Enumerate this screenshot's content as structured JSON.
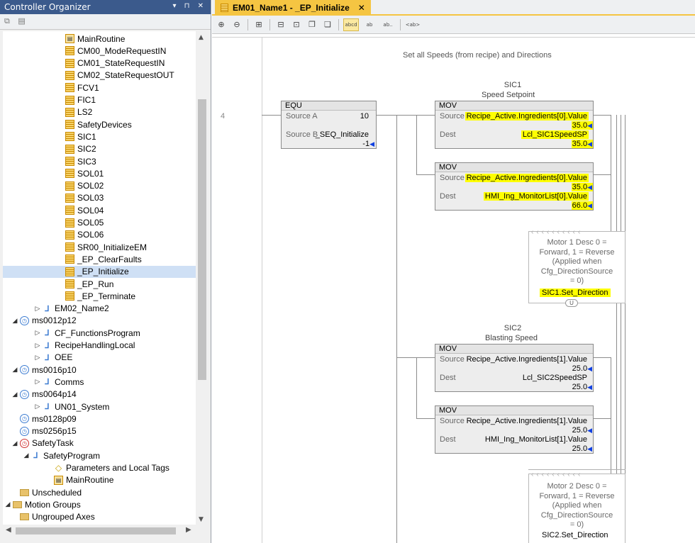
{
  "organizer": {
    "title": "Controller Organizer",
    "controls": "▾ ⊓ ✕",
    "toolbar_icons": [
      "collapse-all-icon",
      "expand-all-icon"
    ],
    "items": [
      {
        "label": "MainRoutine",
        "icon": "main-routine-icon",
        "indent": 5,
        "expander": ""
      },
      {
        "label": "CM00_ModeRequestIN",
        "icon": "routine-icon",
        "indent": 5,
        "expander": ""
      },
      {
        "label": "CM01_StateRequestIN",
        "icon": "routine-icon",
        "indent": 5,
        "expander": ""
      },
      {
        "label": "CM02_StateRequestOUT",
        "icon": "routine-icon",
        "indent": 5,
        "expander": ""
      },
      {
        "label": "FCV1",
        "icon": "routine-icon",
        "indent": 5,
        "expander": ""
      },
      {
        "label": "FIC1",
        "icon": "routine-icon",
        "indent": 5,
        "expander": ""
      },
      {
        "label": "LS2",
        "icon": "routine-icon",
        "indent": 5,
        "expander": ""
      },
      {
        "label": "SafetyDevices",
        "icon": "routine-icon",
        "indent": 5,
        "expander": ""
      },
      {
        "label": "SIC1",
        "icon": "routine-icon",
        "indent": 5,
        "expander": ""
      },
      {
        "label": "SIC2",
        "icon": "routine-icon",
        "indent": 5,
        "expander": ""
      },
      {
        "label": "SIC3",
        "icon": "routine-icon",
        "indent": 5,
        "expander": ""
      },
      {
        "label": "SOL01",
        "icon": "routine-icon",
        "indent": 5,
        "expander": ""
      },
      {
        "label": "SOL02",
        "icon": "routine-icon",
        "indent": 5,
        "expander": ""
      },
      {
        "label": "SOL03",
        "icon": "routine-icon",
        "indent": 5,
        "expander": ""
      },
      {
        "label": "SOL04",
        "icon": "routine-icon",
        "indent": 5,
        "expander": ""
      },
      {
        "label": "SOL05",
        "icon": "routine-icon",
        "indent": 5,
        "expander": ""
      },
      {
        "label": "SOL06",
        "icon": "routine-icon",
        "indent": 5,
        "expander": ""
      },
      {
        "label": "SR00_InitializeEM",
        "icon": "routine-icon",
        "indent": 5,
        "expander": ""
      },
      {
        "label": "_EP_ClearFaults",
        "icon": "routine-icon",
        "indent": 5,
        "expander": ""
      },
      {
        "label": "_EP_Initialize",
        "icon": "routine-icon",
        "indent": 5,
        "expander": "",
        "selected": true
      },
      {
        "label": "_EP_Run",
        "icon": "routine-icon",
        "indent": 5,
        "expander": ""
      },
      {
        "label": "_EP_Terminate",
        "icon": "routine-icon",
        "indent": 5,
        "expander": ""
      },
      {
        "label": "EM02_Name2",
        "icon": "program-icon",
        "indent": 3,
        "expander": "▷"
      },
      {
        "label": "ms0012p12",
        "icon": "periodic-task-icon",
        "indent": 1,
        "expander": "◢"
      },
      {
        "label": "CF_FunctionsProgram",
        "icon": "program-icon",
        "indent": 3,
        "expander": "▷"
      },
      {
        "label": "RecipeHandlingLocal",
        "icon": "program-icon",
        "indent": 3,
        "expander": "▷"
      },
      {
        "label": "OEE",
        "icon": "program-icon",
        "indent": 3,
        "expander": "▷"
      },
      {
        "label": "ms0016p10",
        "icon": "periodic-task-icon",
        "indent": 1,
        "expander": "◢"
      },
      {
        "label": "Comms",
        "icon": "program-icon",
        "indent": 3,
        "expander": "▷"
      },
      {
        "label": "ms0064p14",
        "icon": "periodic-task-icon",
        "indent": 1,
        "expander": "◢"
      },
      {
        "label": "UN01_System",
        "icon": "program-icon",
        "indent": 3,
        "expander": "▷"
      },
      {
        "label": "ms0128p09",
        "icon": "periodic-task-icon",
        "indent": 1,
        "expander": ""
      },
      {
        "label": "ms0256p15",
        "icon": "periodic-task-icon",
        "indent": 1,
        "expander": ""
      },
      {
        "label": "SafetyTask",
        "icon": "safety-task-icon",
        "indent": 1,
        "expander": "◢"
      },
      {
        "label": "SafetyProgram",
        "icon": "safety-program-icon",
        "indent": 2,
        "expander": "◢"
      },
      {
        "label": "Parameters and Local Tags",
        "icon": "tag-icon",
        "indent": 4,
        "expander": ""
      },
      {
        "label": "MainRoutine",
        "icon": "main-routine-icon",
        "indent": 4,
        "expander": ""
      },
      {
        "label": "Unscheduled",
        "icon": "folder-icon",
        "indent": 1,
        "expander": ""
      },
      {
        "label": "Motion Groups",
        "icon": "folder-icon",
        "indent": 0,
        "expander": "◢"
      },
      {
        "label": "Ungrouped Axes",
        "icon": "folder-icon",
        "indent": 1,
        "expander": ""
      }
    ]
  },
  "editor": {
    "tab_label": "EM01_Name1 - _EP_Initialize",
    "tab_close": "✕",
    "toolbar": [
      "zoom-in-icon",
      "zoom-out-icon",
      "sep",
      "verify-icon",
      "sep",
      "rung-icon",
      "branch-icon",
      "copy-icon",
      "paste-icon",
      "sep",
      "tag-desc-toggle-icon",
      "ab-swap-icon",
      "ab-find-icon",
      "sep",
      "ab-tag-icon"
    ],
    "toolbar_labels": {
      "tag-desc-toggle-icon": "abcd",
      "ab-swap-icon": "ab",
      "ab-find-icon": "ab..",
      "ab-tag-icon": "<ab>"
    }
  },
  "ladder": {
    "rung_comment": "Set all Speeds (from recipe) and Directions",
    "rung_number": "4",
    "equ": {
      "name": "EQU",
      "source_a_label": "Source A",
      "source_a_value": "10",
      "source_b_label": "Source B",
      "source_b_tag": "_SEQ_Initialize",
      "source_b_value": "-1"
    },
    "sic1_title": "SIC1",
    "sic1_sub": "Speed Setpoint",
    "sic2_title": "SIC2",
    "sic2_sub": "Blasting Speed",
    "mov1": {
      "name": "MOV",
      "source_label": "Source",
      "source_tag": "Recipe_Active.Ingredients[0].Value",
      "source_value": "35.0",
      "dest_label": "Dest",
      "dest_tag": "Lcl_SIC1SpeedSP",
      "dest_value": "35.0"
    },
    "mov2": {
      "name": "MOV",
      "source_label": "Source",
      "source_tag": "Recipe_Active.Ingredients[0].Value",
      "source_value": "35.0",
      "dest_label": "Dest",
      "dest_tag": "HMI_Ing_MonitorList[0].Value",
      "dest_value": "66.0"
    },
    "mov3": {
      "name": "MOV",
      "source_label": "Source",
      "source_tag": "Recipe_Active.Ingredients[1].Value",
      "source_value": "25.0",
      "dest_label": "Dest",
      "dest_tag": "Lcl_SIC2SpeedSP",
      "dest_value": "25.0"
    },
    "mov4": {
      "name": "MOV",
      "source_label": "Source",
      "source_tag": "Recipe_Active.Ingredients[1].Value",
      "source_value": "25.0",
      "dest_label": "Dest",
      "dest_tag": "HMI_Ing_MonitorList[1].Value",
      "dest_value": "25.0"
    },
    "coil1": {
      "desc": "Motor 1 Desc 0 =\nForward, 1 = Reverse\n(Applied when\nCfg_DirectionSource\n= 0)",
      "tag": "SIC1.Set_Direction",
      "type": "U"
    },
    "coil2": {
      "desc": "Motor 2 Desc 0 =\nForward, 1 = Reverse\n(Applied when\nCfg_DirectionSource\n= 0)",
      "tag": "SIC2.Set_Direction"
    },
    "highlight_color": "#ffff00",
    "value_arrow": "🡄"
  }
}
